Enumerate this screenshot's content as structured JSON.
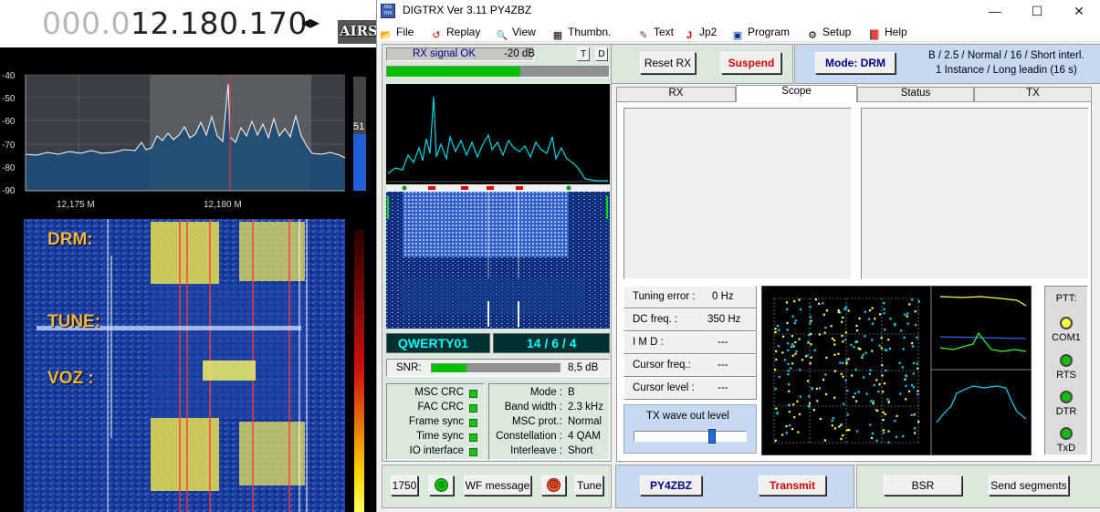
{
  "sdr": {
    "freq_dim": "000.0",
    "freq_main": "12.180.170",
    "step_arrows": "◂▸",
    "brand": "AIRS",
    "db_axis": [
      "-40",
      "-50",
      "-60",
      "-70",
      "-80",
      "-90"
    ],
    "freq_ticks": [
      "12,175 M",
      "12,180 M"
    ],
    "level_value": "51",
    "wf_labels": {
      "drm": "DRM:",
      "tune": "TUNE:",
      "voz": "VOZ :"
    }
  },
  "window": {
    "title": "DIGTRX  Ver 3.11     PY4ZBZ",
    "icon_text": "DIG TRX",
    "controls": {
      "minimize": "—",
      "maximize": "☐",
      "close": "✕"
    }
  },
  "menu": [
    {
      "icon": "folder-icon",
      "glyph": "📂",
      "label": "File"
    },
    {
      "icon": "replay-icon",
      "glyph": "↺",
      "label": "Replay"
    },
    {
      "icon": "magnifier-icon",
      "glyph": "🔍",
      "label": "View"
    },
    {
      "icon": "grid-icon",
      "glyph": "▦",
      "label": "Thumbn."
    },
    {
      "icon": "pencil-icon",
      "glyph": "✎",
      "label": "Text"
    },
    {
      "icon": "jp2-icon",
      "glyph": "J",
      "label": "Jp2"
    },
    {
      "icon": "monitor-icon",
      "glyph": "▣",
      "label": "Program"
    },
    {
      "icon": "setup-icon",
      "glyph": "⚙",
      "label": "Setup"
    },
    {
      "icon": "help-book-icon",
      "glyph": "📕",
      "label": "Help"
    }
  ],
  "signal": {
    "status": "RX signal OK",
    "level_db": "-20 dB",
    "t_label": "T",
    "d_label": "D",
    "level_fraction": 0.6
  },
  "callsign_display": "QWERTY01",
  "counter_display": "14 / 6 / 4",
  "snr": {
    "label": "SNR:",
    "value": "8,5 dB",
    "fraction": 0.27
  },
  "crc": [
    {
      "label": "MSC CRC"
    },
    {
      "label": "FAC CRC"
    },
    {
      "label": "Frame sync"
    },
    {
      "label": "Time sync"
    },
    {
      "label": "IO interface"
    }
  ],
  "params": [
    {
      "key": "Mode :",
      "value": "B"
    },
    {
      "key": "Band width :",
      "value": "2.3 kHz"
    },
    {
      "key": "MSC prot.:",
      "value": "Normal"
    },
    {
      "key": "Constellation :",
      "value": "4 QAM"
    },
    {
      "key": "Interleave :",
      "value": "Short"
    }
  ],
  "top_buttons": {
    "reset_rx": "Reset RX",
    "suspend": "Suspend",
    "mode": "Mode: DRM"
  },
  "mode_info": {
    "line1": "B / 2.5 / Normal / 16 / Short interl.",
    "line2": "1 Instance  /  Long leadin (16 s)"
  },
  "tabs": [
    "RX",
    "Scope",
    "Status",
    "TX"
  ],
  "active_tab": "Scope",
  "status_rows": [
    {
      "key": "Tuning error :",
      "value": "0 Hz"
    },
    {
      "key": "DC freq. :",
      "value": "350 Hz"
    },
    {
      "key": "I M D :",
      "value": "---"
    },
    {
      "key": "Cursor freq.:",
      "value": "---"
    },
    {
      "key": "Cursor level :",
      "value": "---"
    }
  ],
  "tx_wave": {
    "label": "TX wave out level",
    "fraction": 0.7
  },
  "ptt": {
    "title": "PTT:",
    "items": [
      {
        "label": "COM1",
        "state": "yellow"
      },
      {
        "label": "RTS",
        "state": "green"
      },
      {
        "label": "DTR",
        "state": "green"
      },
      {
        "label": "TxD",
        "state": "green"
      }
    ]
  },
  "bottom": {
    "b1750": "1750",
    "wf_message": "WF message",
    "tune": "Tune",
    "callsign": "PY4ZBZ",
    "transmit": "Transmit",
    "bsr": "BSR",
    "send_segments": "Send segments"
  },
  "colors": {
    "navy_text": "#000080",
    "red_text": "#d00000",
    "cyan_display": "#00ffff",
    "display_bg": "#003030",
    "light_green_panel": "#d9ecd9",
    "blue_panel": "#c6d8f2",
    "scope_yellow": "#ffff44",
    "scope_cyan": "#00d8ff"
  }
}
